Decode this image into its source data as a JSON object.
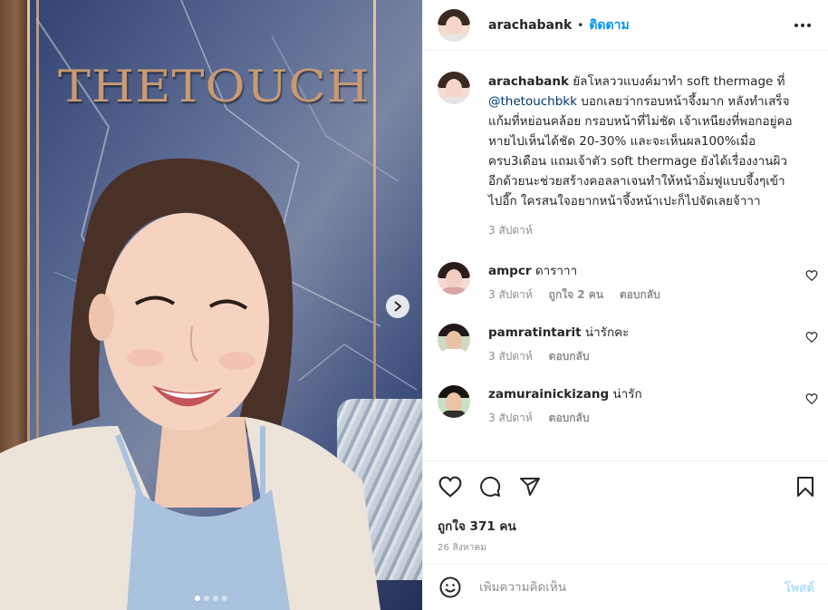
{
  "photo": {
    "sign_text": "THETOUCH",
    "carousel": {
      "count": 4,
      "active_index": 0
    }
  },
  "post": {
    "author": "arachabank",
    "separator": "•",
    "follow_label": "ติดตาม",
    "caption": {
      "username": "arachabank",
      "text_before": " ยัลโหลววแบงค์มาทำ soft thermage ที่ ",
      "mention": "@thetouchbkk",
      "text_after": " บอกเลยว่ากรอบหน้าจึ้งมาก หลังทำเสร็จแก้มที่หย่อนคล้อย กรอบหน้าที่ไม่ชัด เจ้าเหนียงที่พอกอยู่คอ หายไปเห็นได้ชัด 20-30% และจะเห็นผล100%เมื่อครบ3เดือน แถมเจ้าตัว soft thermage ยังได้เรื่องงานผิวอีกด้วยนะช่วยสร้างคอลลาเจนทำให้หน้าอิ่มฟูแบบจึ้งๆเข้าไปอี๊ก ใครสนใจอยากหน้าจึ้งหน้าเปะก็ไปจัดเลยจ้าาา",
      "time": "3 สัปดาห์"
    },
    "comments": [
      {
        "username": "ampcr",
        "text": "ดาราาา",
        "time": "3 สัปดาห์",
        "likes": "ถูกใจ 2 คน",
        "reply": "ตอบกลับ"
      },
      {
        "username": "pamratintarit",
        "text": "น่ารักคะ",
        "time": "3 สัปดาห์",
        "reply": "ตอบกลับ"
      },
      {
        "username": "zamurainickizang",
        "text": "น่ารัก",
        "time": "3 สัปดาห์",
        "reply": "ตอบกลับ"
      }
    ],
    "likes_text": "ถูกใจ 371 คน",
    "date_text": "26 สิงหาคม",
    "add_comment": {
      "placeholder": "เพิ่มความคิดเห็น",
      "post_label": "โพสต์"
    }
  },
  "colors": {
    "link_blue": "#0095f6",
    "mention": "#00376b",
    "muted": "#8e8e8e",
    "post_disabled": "#b2dffc"
  }
}
